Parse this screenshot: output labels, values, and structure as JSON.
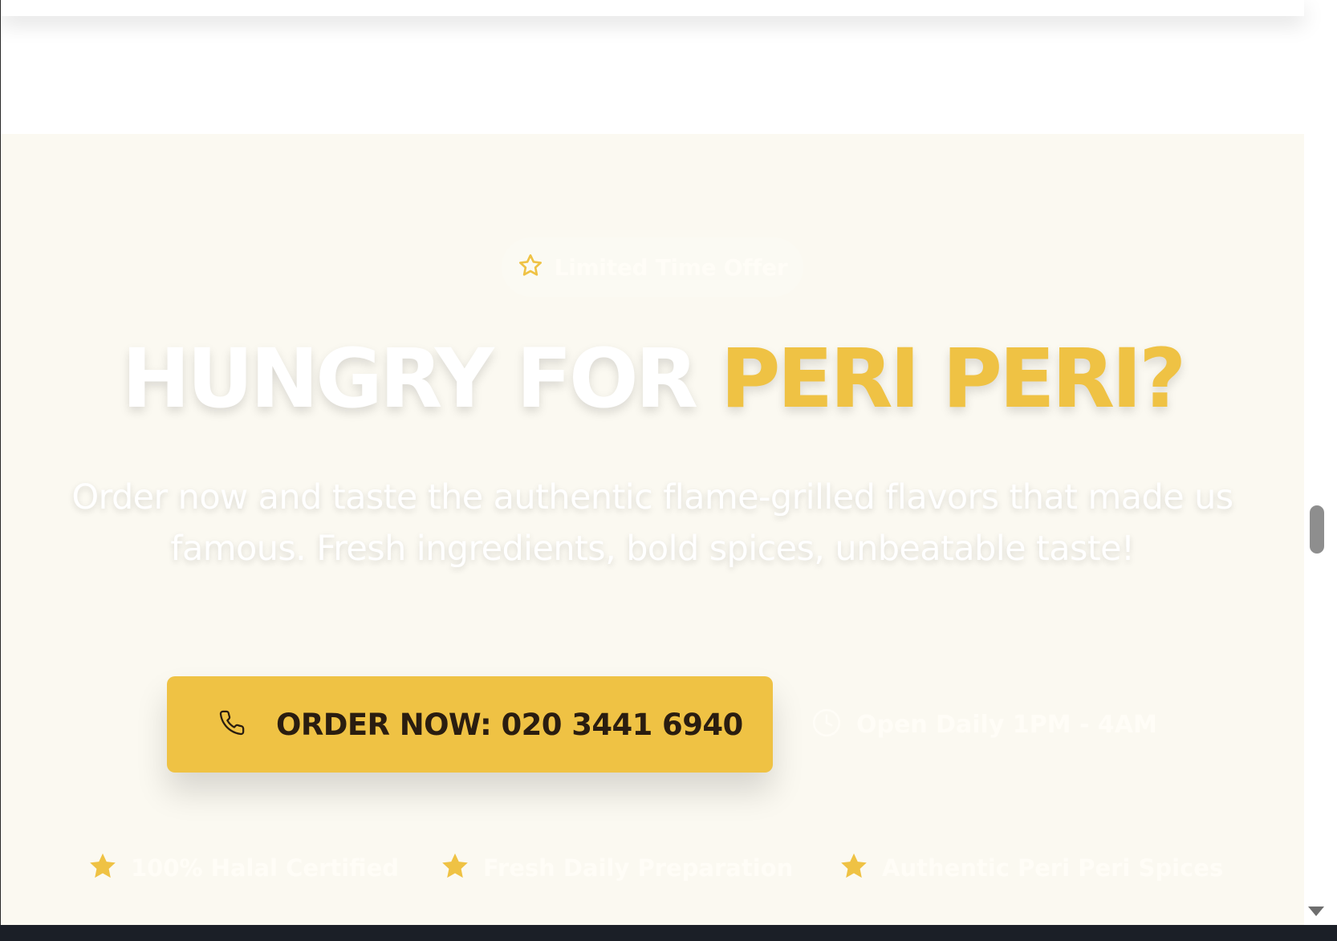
{
  "hero": {
    "badge_text": "Limited Time Offer",
    "badge_icon": "star-outline-icon",
    "headline_part1": "HUNGRY FOR ",
    "headline_part2": "PERI PERI?",
    "subtext": "Order now and taste the authentic flame-grilled flavors that made us famous. Fresh ingredients, bold spices, unbeatable taste!",
    "order_button_label": "ORDER NOW: 020 3441 6940",
    "order_button_icon": "phone-icon",
    "hours_text": "Open Daily 1PM - 4AM",
    "hours_icon": "clock-icon",
    "features": [
      {
        "label": "100% Halal Certified",
        "icon": "star-icon"
      },
      {
        "label": "Fresh Daily Preparation",
        "icon": "star-icon"
      },
      {
        "label": "Authentic Peri Peri Spices",
        "icon": "star-icon"
      }
    ]
  },
  "colors": {
    "accent": "#efc244",
    "hero_background": "#fbf9f1",
    "button_text": "#2a1d10",
    "light_text": "#ffffff"
  }
}
